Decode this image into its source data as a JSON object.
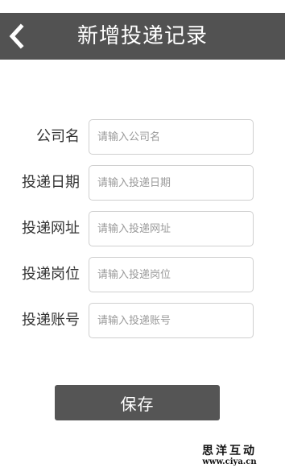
{
  "header": {
    "title": "新增投递记录",
    "back_icon": "chevron-left-icon",
    "background": "#525252"
  },
  "form": {
    "fields": [
      {
        "label": "公司名",
        "placeholder": "请输入公司名",
        "value": ""
      },
      {
        "label": "投递日期",
        "placeholder": "请输入投递日期",
        "value": ""
      },
      {
        "label": "投递网址",
        "placeholder": "请输入投递网址",
        "value": ""
      },
      {
        "label": "投递岗位",
        "placeholder": "请输入投递岗位",
        "value": ""
      },
      {
        "label": "投递账号",
        "placeholder": "请输入投递账号",
        "value": ""
      }
    ],
    "save_label": "保存"
  },
  "watermark": {
    "name": "思洋互动",
    "url": "www.ciya.cn"
  }
}
